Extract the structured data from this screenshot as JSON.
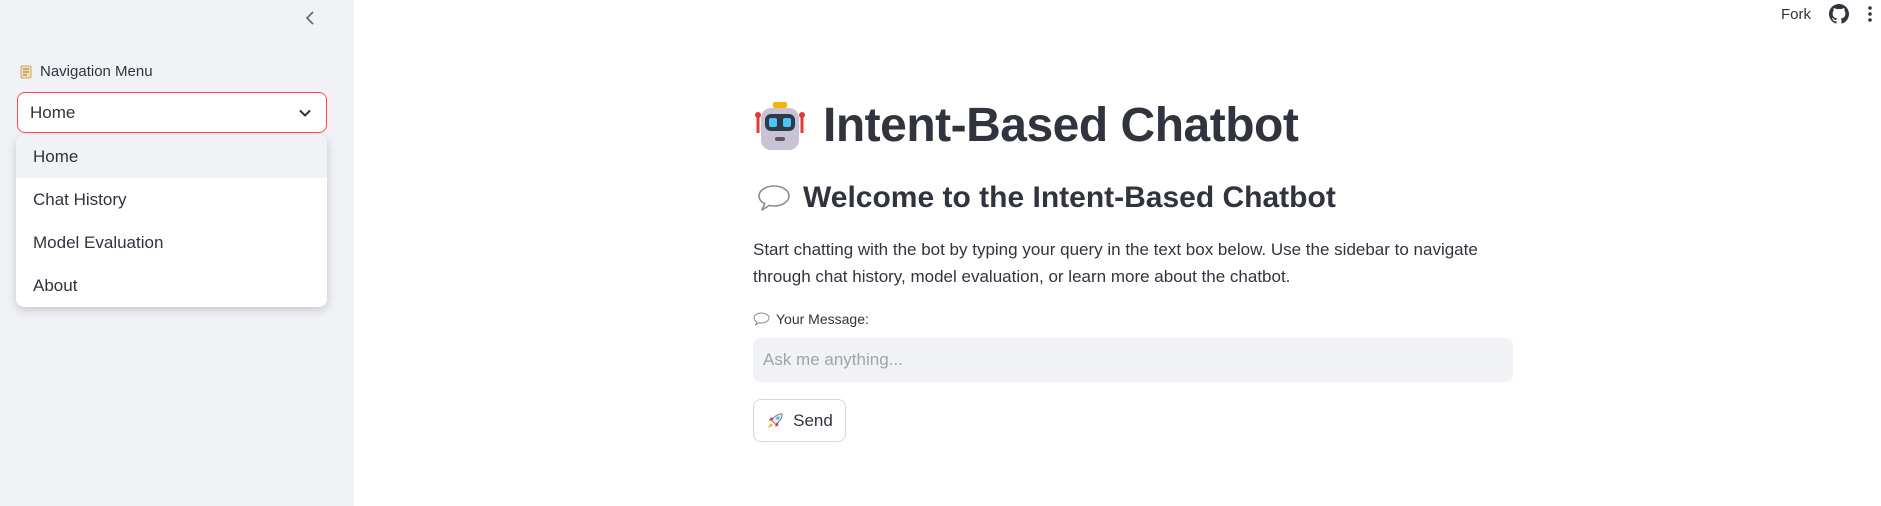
{
  "sidebar": {
    "nav_label": "Navigation Menu",
    "selected": "Home",
    "options": [
      "Home",
      "Chat History",
      "Model Evaluation",
      "About"
    ]
  },
  "topbar": {
    "fork_label": "Fork"
  },
  "main": {
    "title": "Intent-Based Chatbot",
    "subtitle": "Welcome to the Intent-Based Chatbot",
    "description": "Start chatting with the bot by typing your query in the text box below. Use the sidebar to navigate through chat history, model evaluation, or learn more about the chatbot.",
    "message_label": "Your Message:",
    "message_placeholder": "Ask me anything...",
    "message_value": "",
    "send_label": "Send"
  },
  "colors": {
    "accent": "#ff4b4b",
    "sidebar_bg": "#f0f2f6",
    "text": "#31333f"
  },
  "icons": {
    "collapse": "chevron-left-icon",
    "nav_label": "scroll-icon",
    "select": "chevron-down-icon",
    "github": "github-icon",
    "menu": "kebab-menu-icon",
    "title": "robot-icon",
    "subtitle": "speech-bubble-icon",
    "send": "rocket-icon"
  }
}
